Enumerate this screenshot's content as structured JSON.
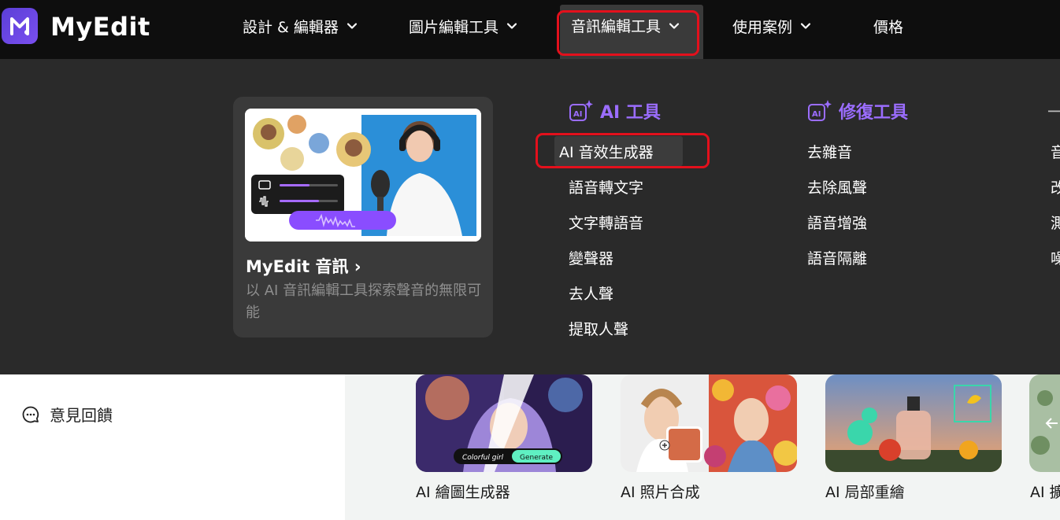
{
  "header": {
    "brand": "MyEdit",
    "nav": [
      {
        "label": "設計 & 編輯器",
        "has_dropdown": true
      },
      {
        "label": "圖片編輯工具",
        "has_dropdown": true
      },
      {
        "label": "音訊編輯工具",
        "has_dropdown": true,
        "active": true
      },
      {
        "label": "使用案例",
        "has_dropdown": true
      },
      {
        "label": "價格",
        "has_dropdown": false
      }
    ]
  },
  "mega_menu": {
    "promo": {
      "title": "MyEdit 音訊",
      "description": "以 AI 音訊編輯工具探索聲音的無限可能"
    },
    "columns": [
      {
        "heading": "AI 工具",
        "icon": "ai-sparkle-icon",
        "items": [
          "AI 音效生成器",
          "語音轉文字",
          "文字轉語音",
          "變聲器",
          "去人聲",
          "提取人聲"
        ]
      },
      {
        "heading": "修復工具",
        "icon": "ai-sparkle-icon",
        "items": [
          "去雜音",
          "去除風聲",
          "語音增強",
          "語音隔離"
        ]
      },
      {
        "heading": "一",
        "items": [
          "音",
          "改",
          "測",
          "噪"
        ]
      }
    ]
  },
  "sidebar": {
    "feedback_label": "意見回饋"
  },
  "cards": [
    {
      "label": "AI 繪圖生成器",
      "overlay_text": "Colorful girl",
      "overlay_button": "Generate"
    },
    {
      "label": "AI 照片合成"
    },
    {
      "label": "AI 局部重繪"
    },
    {
      "label": "AI 擴"
    }
  ],
  "colors": {
    "accent": "#9b6dff",
    "topbar": "#0e0e0e",
    "panel": "#2a2a2a",
    "highlight_box": "#e3101c"
  }
}
